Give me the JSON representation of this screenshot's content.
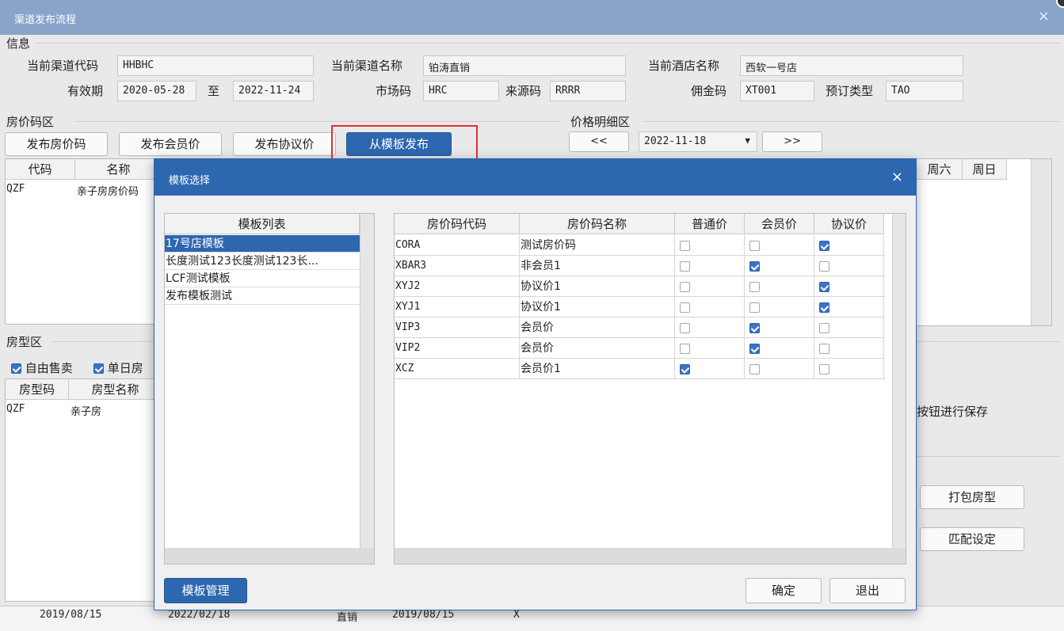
{
  "window": {
    "title": "渠道发布流程",
    "close": "×"
  },
  "info": {
    "group_title": "信息",
    "channel_code_label": "当前渠道代码",
    "channel_code": "HHBHC",
    "channel_name_label": "当前渠道名称",
    "channel_name": "铂涛直销",
    "hotel_name_label": "当前酒店名称",
    "hotel_name": "西软一号店",
    "valid_label": "有效期",
    "valid_from": "2020-05-28",
    "to_label": "至",
    "valid_to": "2022-11-24",
    "market_label": "市场码",
    "market": "HRC",
    "source_label": "来源码",
    "source": "RRRR",
    "commission_label": "佣金码",
    "commission": "XT001",
    "booking_type_label": "预订类型",
    "booking_type": "TAO"
  },
  "rate_area": {
    "title": "房价码区",
    "buttons": [
      "发布房价码",
      "发布会员价",
      "发布协议价",
      "从模板发布"
    ],
    "columns": [
      "代码",
      "名称"
    ],
    "rows": [
      {
        "code": "QZF",
        "name": "亲子房房价码"
      }
    ]
  },
  "price_detail": {
    "title": "价格明细区",
    "prev": "<<",
    "date": "2022-11-18",
    "next": ">>",
    "weekday_headers": [
      "周六",
      "周日"
    ]
  },
  "room_area": {
    "title": "房型区",
    "free_sale_label": "自由售卖",
    "single_day_label": "单日房",
    "columns": [
      "房型码",
      "房型名称"
    ],
    "rows": [
      {
        "code": "QZF",
        "name": "亲子房"
      }
    ]
  },
  "hint": "按钮进行保存",
  "side_buttons": {
    "package": "打包房型",
    "match": "匹配设定"
  },
  "statusbar": {
    "c1": "2019/08/15",
    "c2": "2022/02/18",
    "c3": "直销",
    "c4": "2019/08/15",
    "c5": "X"
  },
  "dialog": {
    "title": "模板选择",
    "close": "×",
    "list_header": "模板列表",
    "templates": [
      "17号店模板",
      "长度测试123长度测试123长...",
      "LCF测试模板",
      "发布模板测试"
    ],
    "selected_index": 0,
    "columns": [
      "房价码代码",
      "房价码名称",
      "普通价",
      "会员价",
      "协议价"
    ],
    "rows": [
      {
        "code": "CORA",
        "name": "测试房价码",
        "normal": false,
        "member": false,
        "agreement": true
      },
      {
        "code": "XBAR3",
        "name": "非会员1",
        "normal": false,
        "member": true,
        "agreement": false
      },
      {
        "code": "XYJ2",
        "name": "协议价1",
        "normal": false,
        "member": false,
        "agreement": true
      },
      {
        "code": "XYJ1",
        "name": "协议价1",
        "normal": false,
        "member": false,
        "agreement": true
      },
      {
        "code": "VIP3",
        "name": "会员价",
        "normal": false,
        "member": true,
        "agreement": false
      },
      {
        "code": "VIP2",
        "name": "会员价",
        "normal": false,
        "member": true,
        "agreement": false
      },
      {
        "code": "XCZ",
        "name": "会员价1",
        "normal": true,
        "member": false,
        "agreement": false
      }
    ],
    "manage_button": "模板管理",
    "ok_button": "确定",
    "exit_button": "退出"
  }
}
